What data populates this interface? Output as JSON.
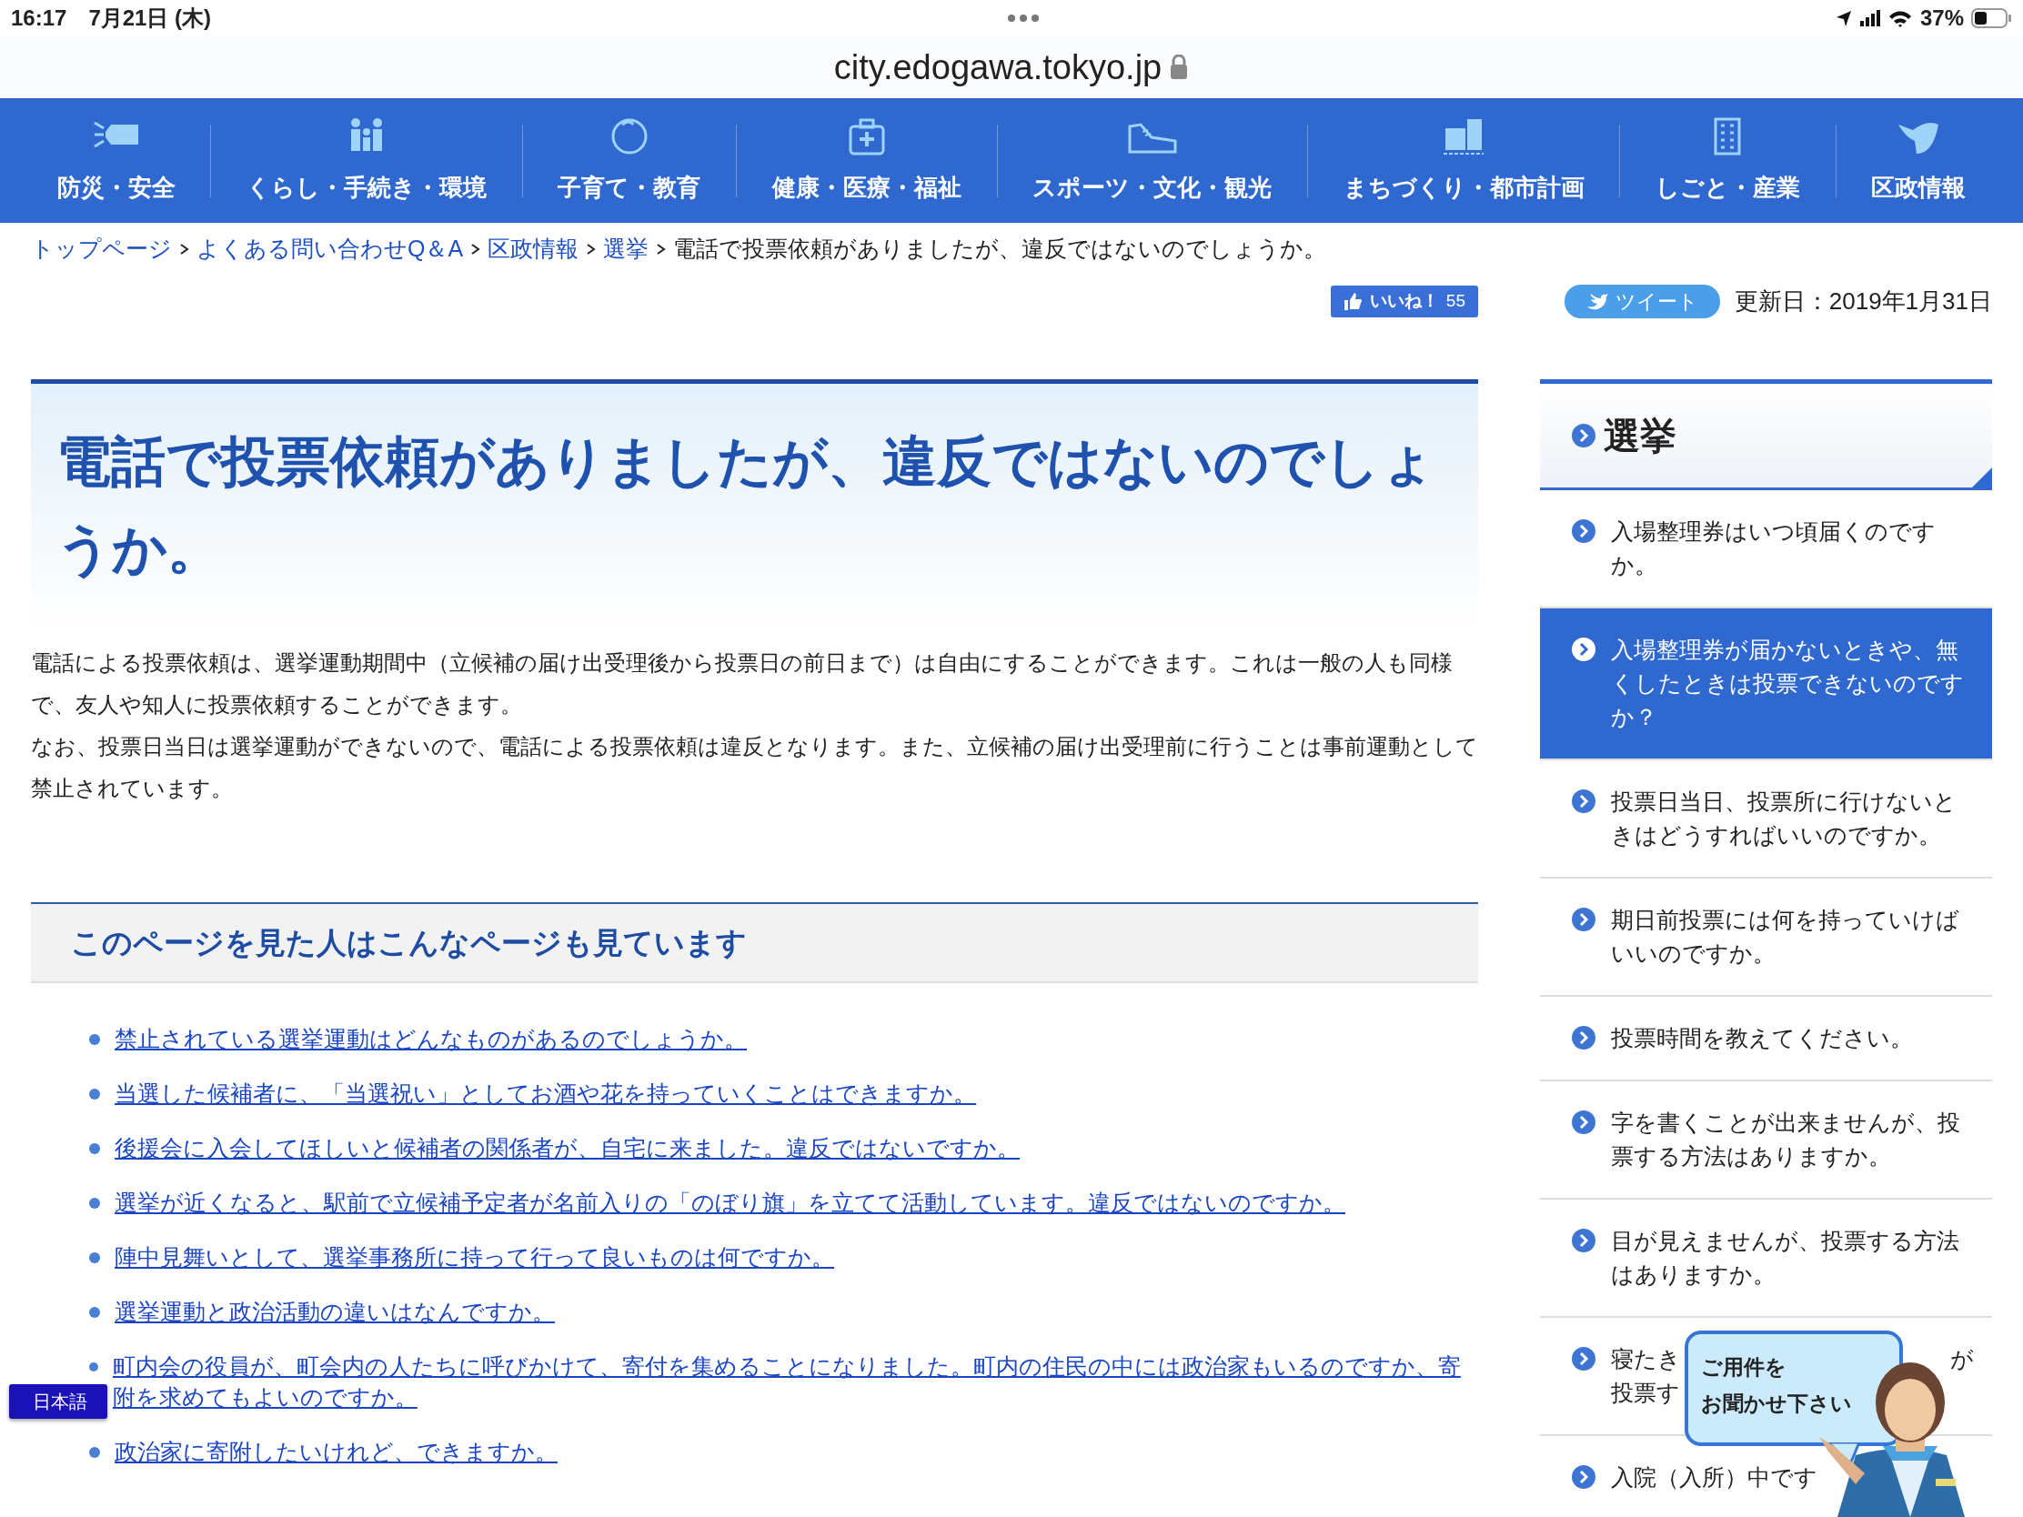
{
  "status_bar": {
    "time": "16:17",
    "date": "7月21日 (木)",
    "battery": "37%"
  },
  "url_bar": {
    "address": "city.edogawa.tokyo.jp"
  },
  "nav": [
    {
      "label": "防災・安全"
    },
    {
      "label": "くらし・手続き・環境"
    },
    {
      "label": "子育て・教育"
    },
    {
      "label": "健康・医療・福祉"
    },
    {
      "label": "スポーツ・文化・観光"
    },
    {
      "label": "まちづくり・都市計画"
    },
    {
      "label": "しごと・産業"
    },
    {
      "label": "区政情報"
    }
  ],
  "breadcrumb": [
    {
      "label": "トップページ",
      "kind": "link"
    },
    {
      "label": "よくある問い合わせQ＆A",
      "kind": "link"
    },
    {
      "label": "区政情報",
      "kind": "link"
    },
    {
      "label": "選挙",
      "kind": "link"
    },
    {
      "label": "電話で投票依頼がありましたが、違反ではないのでしょうか。",
      "kind": "current"
    }
  ],
  "social": {
    "like_label": "いいね！",
    "like_count": "55",
    "tweet": "ツイート",
    "updated": "更新日：2019年1月31日"
  },
  "article": {
    "title": "電話で投票依頼がありましたが、違反ではないのでしょうか。",
    "paragraphs": [
      "電話による投票依頼は、選挙運動期間中（立候補の届け出受理後から投票日の前日まで）は自由にすることができます。これは一般の人も同様で、友人や知人に投票依頼することができます。",
      "なお、投票日当日は選挙運動ができないので、電話による投票依頼は違反となります。また、立候補の届け出受理前に行うことは事前運動として禁止されています。"
    ]
  },
  "related": {
    "heading": "このページを見た人はこんなページも見ています",
    "links": [
      "禁止されている選挙運動はどんなものがあるのでしょうか。",
      "当選した候補者に、「当選祝い」としてお酒や花を持っていくことはできますか。",
      "後援会に入会してほしいと候補者の関係者が、自宅に来ました。違反ではないですか。",
      "選挙が近くなると、駅前で立候補予定者が名前入りの「のぼり旗」を立てて活動しています。違反ではないのですか。",
      "陣中見舞いとして、選挙事務所に持って行って良いものは何ですか。",
      "選挙運動と政治活動の違いはなんですか。",
      "町内会の役員が、町会内の人たちに呼びかけて、寄付を集めることになりました。町内の住民の中には政治家もいるのですか、寄附を求めてもよいのですか。",
      "政治家に寄附したいけれど、できますか。"
    ]
  },
  "sidebar": {
    "heading": "選挙",
    "items": [
      {
        "text": "入場整理券はいつ頃届くのですか。",
        "selected": false
      },
      {
        "text": "入場整理券が届かないときや、無くしたときは投票できないのですか？",
        "selected": true
      },
      {
        "text": "投票日当日、投票所に行けないときはどうすればいいのですか。",
        "selected": false
      },
      {
        "text": "期日前投票には何を持っていけばいいのですか。",
        "selected": false
      },
      {
        "text": "投票時間を教えてください。",
        "selected": false
      },
      {
        "text": "字を書くことが出来ませんが、投票する方法はありますか。",
        "selected": false
      },
      {
        "text": "目が見えませんが、投票する方法はありますか。",
        "selected": false
      },
      {
        "kind": "covered",
        "pieces": [
          "寝たき",
          "が",
          "投票す"
        ],
        "selected": false
      },
      {
        "kind": "covered",
        "pieces": [
          "入院（入所）中です"
        ],
        "selected": false
      }
    ]
  },
  "language_button": "日本語",
  "assistant": {
    "lines": [
      "ご用件を",
      "お聞かせ下さい"
    ]
  }
}
